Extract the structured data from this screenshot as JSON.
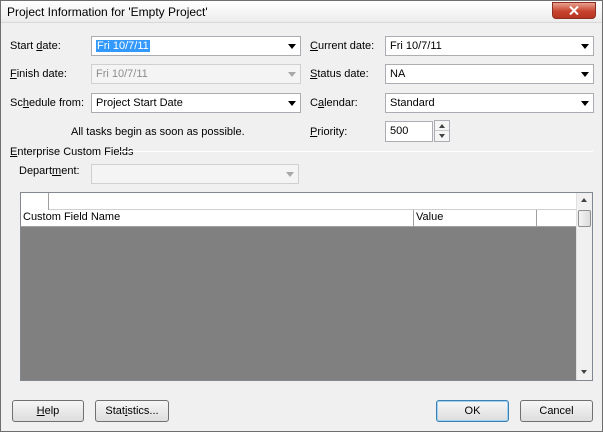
{
  "window": {
    "title": "Project Information for 'Empty Project'",
    "close_icon": "close-x-icon"
  },
  "fields": {
    "start_date": {
      "label_pre": "Start ",
      "label_key": "d",
      "label_post": "ate:",
      "value": "Fri 10/7/11"
    },
    "finish_date": {
      "label_pre": "",
      "label_key": "F",
      "label_post": "inish date:",
      "value": "Fri 10/7/11"
    },
    "schedule_from": {
      "label_pre": "Sc",
      "label_key": "h",
      "label_post": "edule from:",
      "value": "Project Start Date"
    },
    "schedule_note": "All tasks begin as soon as possible.",
    "current_date": {
      "label_pre": "",
      "label_key": "C",
      "label_post": "urrent date:",
      "value": "Fri 10/7/11"
    },
    "status_date": {
      "label_pre": "",
      "label_key": "S",
      "label_post": "tatus date:",
      "value": "NA"
    },
    "calendar": {
      "label_pre": "C",
      "label_key": "a",
      "label_post": "lendar:",
      "value": "Standard"
    },
    "priority": {
      "label_pre": "",
      "label_key": "P",
      "label_post": "riority:",
      "value": "500"
    }
  },
  "enterprise": {
    "group_label_pre": "",
    "group_label_key": "E",
    "group_label_post": "nterprise Custom Fields",
    "department_label_pre": "Depart",
    "department_label_key": "m",
    "department_label_post": "ent:",
    "department_value": "",
    "columns": [
      "Custom Field Name",
      "Value"
    ]
  },
  "buttons": {
    "help_key": "H",
    "help_rest": "elp",
    "statistics_pre": "Stat",
    "statistics_key": "i",
    "statistics_post": "stics...",
    "ok": "OK",
    "cancel": "Cancel"
  },
  "colors": {
    "selection": "#3399ff",
    "grid_background": "#808080",
    "close_button": "#c7432e"
  }
}
